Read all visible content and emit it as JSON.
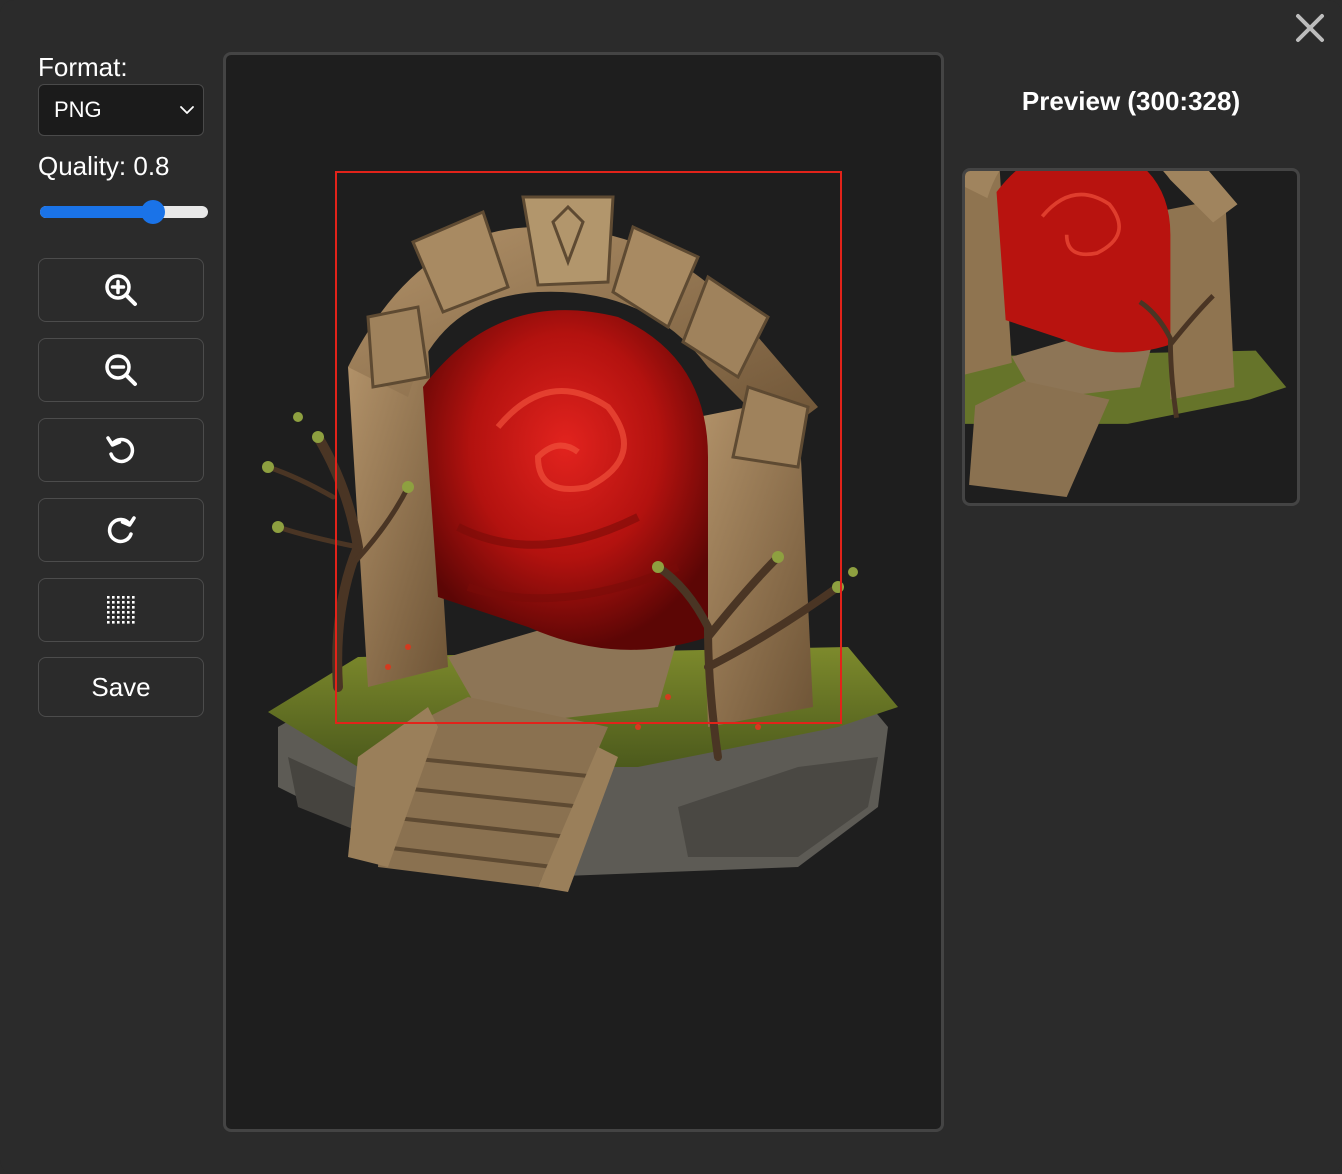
{
  "dialog": {
    "close_icon": "close-icon"
  },
  "controls": {
    "format_label": "Format:",
    "format_value": "PNG",
    "quality_label": "Quality: 0.8",
    "quality_value": 0.8,
    "tools": [
      {
        "name": "zoom-in",
        "icon": "zoom-in-icon"
      },
      {
        "name": "zoom-out",
        "icon": "zoom-out-icon"
      },
      {
        "name": "rotate-left",
        "icon": "rotate-left-icon"
      },
      {
        "name": "rotate-right",
        "icon": "rotate-right-icon"
      },
      {
        "name": "grid",
        "icon": "grid-icon"
      }
    ],
    "save_label": "Save"
  },
  "preview": {
    "title": "Preview (300:328)"
  },
  "colors": {
    "accent": "#1a73e8",
    "crop_border": "#e2231a",
    "background": "#2b2b2b",
    "canvas": "#1e1e1e"
  }
}
